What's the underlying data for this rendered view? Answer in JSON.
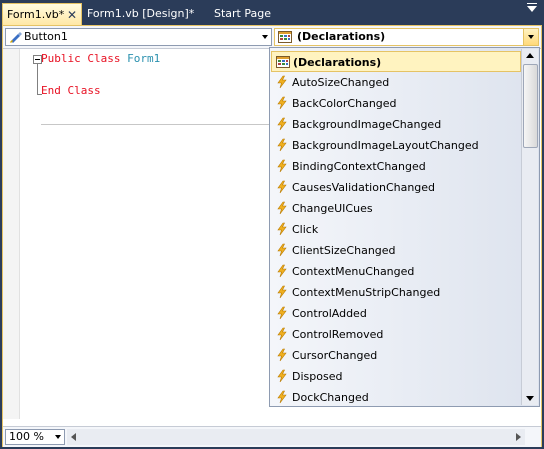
{
  "tabs": [
    {
      "label": "Form1.vb*",
      "active": true
    },
    {
      "label": "Form1.vb [Design]*",
      "active": false
    },
    {
      "label": "Start Page",
      "active": false
    }
  ],
  "navbar": {
    "class_combo": {
      "value": "Button1",
      "icon": "control-icon"
    },
    "member_combo": {
      "value": "(Declarations)",
      "icon": "declarations-icon"
    }
  },
  "code": {
    "line1": {
      "kw1": "Public",
      "kw2": "Class",
      "name": "Form1"
    },
    "line3": {
      "kw1": "End",
      "kw2": "Class"
    }
  },
  "dropdown": {
    "items": [
      {
        "label": "(Declarations)",
        "icon": "declarations-icon",
        "selected": true
      },
      {
        "label": "AutoSizeChanged",
        "icon": "event-icon"
      },
      {
        "label": "BackColorChanged",
        "icon": "event-icon"
      },
      {
        "label": "BackgroundImageChanged",
        "icon": "event-icon"
      },
      {
        "label": "BackgroundImageLayoutChanged",
        "icon": "event-icon"
      },
      {
        "label": "BindingContextChanged",
        "icon": "event-icon"
      },
      {
        "label": "CausesValidationChanged",
        "icon": "event-icon"
      },
      {
        "label": "ChangeUICues",
        "icon": "event-icon"
      },
      {
        "label": "Click",
        "icon": "event-icon"
      },
      {
        "label": "ClientSizeChanged",
        "icon": "event-icon"
      },
      {
        "label": "ContextMenuChanged",
        "icon": "event-icon"
      },
      {
        "label": "ContextMenuStripChanged",
        "icon": "event-icon"
      },
      {
        "label": "ControlAdded",
        "icon": "event-icon"
      },
      {
        "label": "ControlRemoved",
        "icon": "event-icon"
      },
      {
        "label": "CursorChanged",
        "icon": "event-icon"
      },
      {
        "label": "Disposed",
        "icon": "event-icon"
      },
      {
        "label": "DockChanged",
        "icon": "event-icon"
      }
    ]
  },
  "bottom": {
    "zoom": "100 %"
  },
  "colors": {
    "chrome": "#2b3c59",
    "keyword": "#e81123",
    "type_name": "#2b91af",
    "selection": "#fff3c0"
  }
}
